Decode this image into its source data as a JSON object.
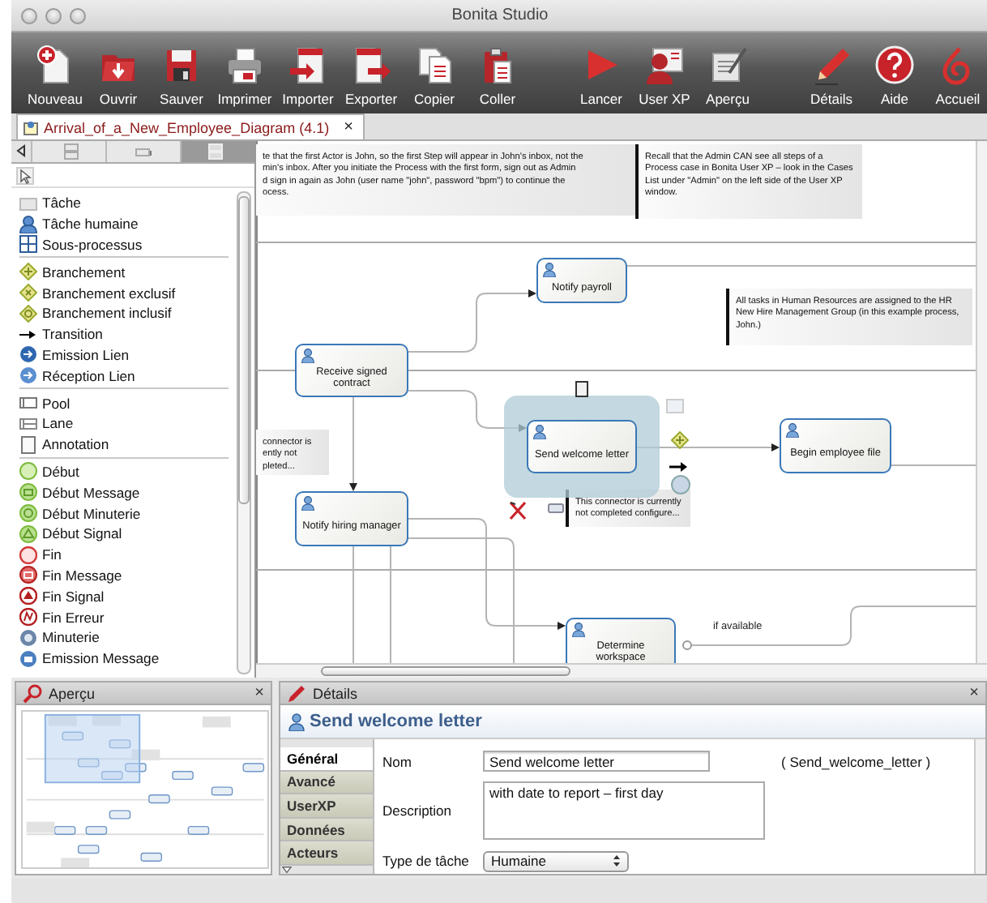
{
  "window": {
    "title": "Bonita Studio"
  },
  "toolbar": {
    "groups": [
      {
        "items": [
          {
            "label": "Nouveau",
            "kind": "new"
          },
          {
            "label": "Ouvrir",
            "kind": "open"
          },
          {
            "label": "Sauver",
            "kind": "save"
          },
          {
            "label": "Imprimer",
            "kind": "print"
          },
          {
            "label": "Importer",
            "kind": "import"
          },
          {
            "label": "Exporter",
            "kind": "export"
          },
          {
            "label": "Copier",
            "kind": "copy"
          },
          {
            "label": "Coller",
            "kind": "paste"
          }
        ]
      },
      {
        "items": [
          {
            "label": "Lancer",
            "kind": "run"
          },
          {
            "label": "User XP",
            "kind": "userxp"
          },
          {
            "label": "Aperçu",
            "kind": "preview"
          }
        ]
      },
      {
        "items": [
          {
            "label": "Détails",
            "kind": "details"
          },
          {
            "label": "Aide",
            "kind": "help"
          },
          {
            "label": "Accueil",
            "kind": "home"
          }
        ]
      }
    ]
  },
  "editor_tabs": [
    {
      "label": "Arrival_of_a_New_Employee_Diagram (4.1)",
      "selected": true,
      "close": "×"
    }
  ],
  "palette": {
    "tabs": [
      {
        "selected": false
      },
      {
        "selected": false
      },
      {
        "selected": true
      }
    ],
    "groups": [
      {
        "items": [
          {
            "label": "Tâche",
            "kind": "task"
          },
          {
            "label": "Tâche humaine",
            "kind": "human-task"
          },
          {
            "label": "Sous-processus",
            "kind": "subprocess"
          }
        ]
      },
      {
        "items": [
          {
            "label": "Branchement",
            "kind": "gateway"
          },
          {
            "label": "Branchement exclusif",
            "kind": "gateway-x"
          },
          {
            "label": "Branchement inclusif",
            "kind": "gateway-o"
          },
          {
            "label": "Transition",
            "kind": "transition"
          },
          {
            "label": "Emission Lien",
            "kind": "link-throw"
          },
          {
            "label": "Réception Lien",
            "kind": "link-catch"
          }
        ]
      },
      {
        "items": [
          {
            "label": "Pool",
            "kind": "pool"
          },
          {
            "label": "Lane",
            "kind": "lane"
          },
          {
            "label": "Annotation",
            "kind": "annotation"
          }
        ]
      },
      {
        "items": [
          {
            "label": "Début",
            "kind": "start"
          },
          {
            "label": "Début Message",
            "kind": "start-message"
          },
          {
            "label": "Début Minuterie",
            "kind": "start-timer"
          },
          {
            "label": "Début Signal",
            "kind": "start-signal"
          },
          {
            "label": "Fin",
            "kind": "end"
          },
          {
            "label": "Fin Message",
            "kind": "end-message"
          },
          {
            "label": "Fin Signal",
            "kind": "end-signal"
          },
          {
            "label": "Fin Erreur",
            "kind": "end-error"
          },
          {
            "label": "Minuterie",
            "kind": "timer"
          },
          {
            "label": "Emission Message",
            "kind": "throw-message"
          }
        ]
      }
    ]
  },
  "diagram": {
    "notes": [
      {
        "lines": [
          "te that the first Actor is John, so the first Step will appear in John's inbox, not the",
          "min's inbox.  After you initiate the Process with the first form, sign out as Admin",
          "d sign in again as John (user name \"john\", password \"bpm\") to continue the",
          "ocess."
        ]
      },
      {
        "lines": [
          "Recall that the Admin CAN see all steps of a",
          "Process case in Bonita User XP – look in the Cases",
          "List under \"Admin\" on the left side of the User XP",
          "window."
        ]
      },
      {
        "lines": [
          "All tasks in Human Resources are assigned to the  HR",
          "New Hire Management Group (in this example process,",
          "John.)"
        ]
      },
      {
        "lines": [
          "connector is",
          "ently not",
          "pleted..."
        ]
      },
      {
        "lines": [
          "This connector is currently",
          "not completed configure..."
        ]
      }
    ],
    "tasks": [
      {
        "label": "Notify payroll",
        "selected": false
      },
      {
        "label": "Receive signed contract",
        "selected": false
      },
      {
        "label": "Send welcome letter",
        "selected": true
      },
      {
        "label": "Begin employee file",
        "selected": false
      },
      {
        "label": "Notify hiring manager",
        "selected": false
      },
      {
        "label": "Determine workspace",
        "selected": false
      }
    ],
    "edge_labels": [
      "if available"
    ]
  },
  "overview": {
    "title": "Aperçu",
    "close": "×"
  },
  "details": {
    "title": "Détails",
    "close": "×",
    "element": "Send welcome letter",
    "tabs": [
      {
        "label": "Général",
        "selected": true
      },
      {
        "label": "Avancé",
        "selected": false
      },
      {
        "label": "UserXP",
        "selected": false
      },
      {
        "label": "Données",
        "selected": false
      },
      {
        "label": "Acteurs",
        "selected": false
      }
    ],
    "fields": [
      {
        "kind": "text",
        "label": "Nom",
        "value": "Send welcome letter",
        "note": "( Send_welcome_letter )"
      },
      {
        "kind": "textarea",
        "label": "Description",
        "value": "with date to report – first day"
      },
      {
        "kind": "select",
        "label": "Type de tâche",
        "value": "Humaine"
      }
    ]
  }
}
